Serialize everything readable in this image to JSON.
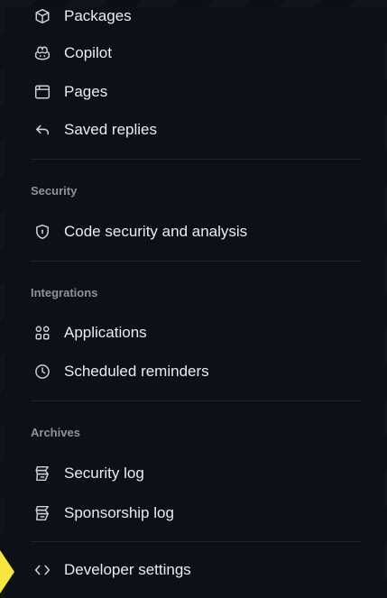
{
  "nav": {
    "packages": {
      "label": "Packages",
      "icon": "package-icon"
    },
    "copilot": {
      "label": "Copilot",
      "icon": "copilot-icon"
    },
    "pages": {
      "label": "Pages",
      "icon": "browser-icon"
    },
    "saved_replies": {
      "label": "Saved replies",
      "icon": "reply-icon"
    }
  },
  "security": {
    "title": "Security",
    "items": [
      {
        "label": "Code security and analysis",
        "icon": "shield-icon"
      }
    ]
  },
  "integrations": {
    "title": "Integrations",
    "items": [
      {
        "label": "Applications",
        "icon": "apps-icon"
      },
      {
        "label": "Scheduled reminders",
        "icon": "clock-icon"
      }
    ]
  },
  "archives": {
    "title": "Archives",
    "items": [
      {
        "label": "Security log",
        "icon": "log-icon"
      },
      {
        "label": "Sponsorship log",
        "icon": "log-icon"
      }
    ]
  },
  "developer": {
    "label": "Developer settings",
    "icon": "code-icon"
  },
  "colors": {
    "background": "#0d1117",
    "text": "#e6edf3",
    "section_title": "#8b949e",
    "divider": "#21262d",
    "pointer": "#f5e642"
  }
}
